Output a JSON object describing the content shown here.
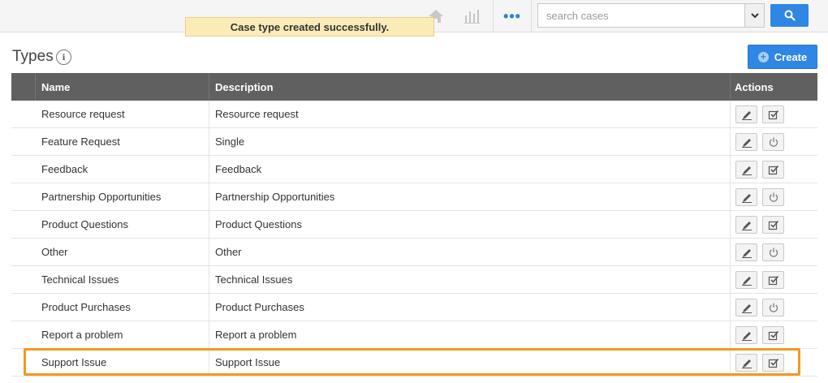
{
  "topbar": {
    "home_icon": "home-icon",
    "stats_icon": "bar-chart-icon",
    "more_icon": "more-dots-icon",
    "more_glyph": "•••",
    "search": {
      "placeholder": "search cases",
      "value": ""
    },
    "search_button_icon": "search-icon"
  },
  "notification": {
    "text": "Case type created successfully."
  },
  "page": {
    "title": "Types",
    "info_glyph": "i",
    "create_label": "Create",
    "create_glyph": "+"
  },
  "table": {
    "columns": {
      "name": "Name",
      "description": "Description",
      "actions": "Actions"
    },
    "rows": [
      {
        "name": "Resource request",
        "description": "Resource request",
        "second_action": "enable"
      },
      {
        "name": "Feature Request",
        "description": "Single",
        "second_action": "disable"
      },
      {
        "name": "Feedback",
        "description": "Feedback",
        "second_action": "enable"
      },
      {
        "name": "Partnership Opportunities",
        "description": "Partnership Opportunities",
        "second_action": "disable"
      },
      {
        "name": "Product Questions",
        "description": "Product Questions",
        "second_action": "enable"
      },
      {
        "name": "Other",
        "description": "Other",
        "second_action": "disable"
      },
      {
        "name": "Technical Issues",
        "description": "Technical Issues",
        "second_action": "enable"
      },
      {
        "name": "Product Purchases",
        "description": "Product Purchases",
        "second_action": "disable"
      },
      {
        "name": "Report a problem",
        "description": "Report a problem",
        "second_action": "enable"
      },
      {
        "name": "Support Issue",
        "description": "Support Issue",
        "second_action": "enable"
      }
    ],
    "highlighted_row": 9
  },
  "colors": {
    "accent": "#2f86e4",
    "header_bg": "#606060",
    "toast_bg": "#fbecb7",
    "highlight": "#f39a1e"
  }
}
